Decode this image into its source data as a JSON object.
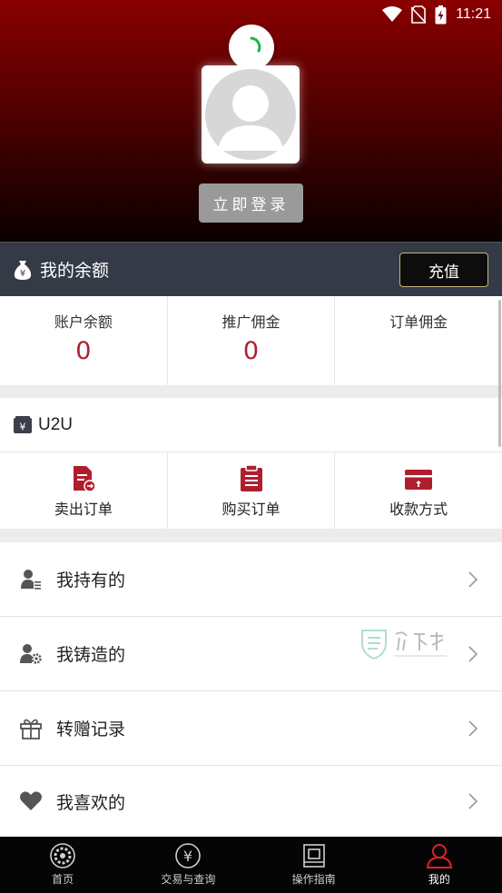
{
  "status_bar": {
    "time": "11:21"
  },
  "profile": {
    "login_button": "立即登录"
  },
  "balance": {
    "title": "我的余额",
    "recharge_button": "充值"
  },
  "stats": [
    {
      "label": "账户余额",
      "value": "0"
    },
    {
      "label": "推广佣金",
      "value": "0"
    },
    {
      "label": "订单佣金",
      "value": ""
    }
  ],
  "u2u": {
    "title": "U2U",
    "actions": [
      {
        "label": "卖出订单",
        "icon": "sell-order-icon"
      },
      {
        "label": "购买订单",
        "icon": "buy-order-icon"
      },
      {
        "label": "收款方式",
        "icon": "payment-method-icon"
      }
    ]
  },
  "menu": [
    {
      "label": "我持有的",
      "icon": "user-list-icon"
    },
    {
      "label": "我铸造的",
      "icon": "user-gear-icon"
    },
    {
      "label": "转赠记录",
      "icon": "gift-icon"
    },
    {
      "label": "我喜欢的",
      "icon": "heart-icon"
    }
  ],
  "tabbar": [
    {
      "label": "首页",
      "icon": "home-gear-icon",
      "active": false
    },
    {
      "label": "交易与查询",
      "icon": "yen-circle-icon",
      "active": false
    },
    {
      "label": "操作指南",
      "icon": "guide-book-icon",
      "active": false
    },
    {
      "label": "我的",
      "icon": "user-icon",
      "active": true
    }
  ],
  "colors": {
    "accent": "#b01e2e",
    "active_tab": "#e0202a",
    "header_top": "#8a0000",
    "balance_bar": "#353a47"
  }
}
